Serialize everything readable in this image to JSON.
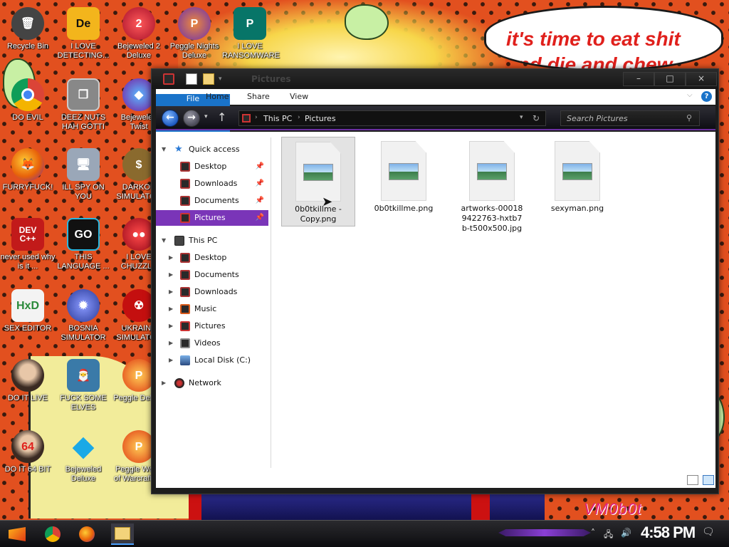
{
  "wallpaper": {
    "speech_bubble": "it's time to eat shit\nand die and chew",
    "signature": "VM0b0t"
  },
  "desktop_icons": [
    {
      "label": "Recycle Bin",
      "icon": "recycle-bin-icon",
      "color": "#444444"
    },
    {
      "label": "I LOVE DETECTING...",
      "icon": "detective-app-icon",
      "color": "#1a1a1a"
    },
    {
      "label": "Bejeweled 2 Deluxe",
      "icon": "bejeweled-2-icon",
      "color": "#d8182c"
    },
    {
      "label": "Peggle Nights Deluxe",
      "icon": "peggle-nights-icon",
      "color": "#6a2fb0"
    },
    {
      "label": "I LOVE RANSOMWARE",
      "icon": "publisher-icon",
      "color": "#077568"
    },
    {
      "label": "DO EVIL",
      "icon": "chrome-icon",
      "color": "#2d9e44"
    },
    {
      "label": "DEEZ NUTS HAH GOTTI",
      "icon": "copy-windows-icon",
      "color": "#777777"
    },
    {
      "label": "Bejeweled Twist",
      "icon": "bejeweled-twist-icon",
      "color": "#7a1a9e"
    },
    {
      "label": "FURRYFUCK!",
      "icon": "firefox-icon",
      "color": "#e8620a"
    },
    {
      "label": "ILL SPY ON YOU",
      "icon": "network-spy-icon",
      "color": "#9aa7b8"
    },
    {
      "label": "DARKOK SIMULATOR",
      "icon": "money-bag-icon",
      "color": "#8a6a2e"
    },
    {
      "label": "never used why is it ...",
      "icon": "devcpp-icon",
      "color": "#c21a1a"
    },
    {
      "label": "THIS LANGUAGE ...",
      "icon": "golang-icon",
      "color": "#1a1a1a"
    },
    {
      "label": "I LOVE CHUZZLE",
      "icon": "chuzzle-icon",
      "color": "#c2102a"
    },
    {
      "label": "SEX EDITOR",
      "icon": "hxd-editor-icon",
      "color": "#f3f3f3"
    },
    {
      "label": "BOSNIA SIMULATOR",
      "icon": "mine-icon",
      "color": "#4a5ab8"
    },
    {
      "label": "UKRAINE SIMULATOR",
      "icon": "radiation-icon",
      "color": "#c40f0f"
    },
    {
      "label": "DO IT LIVE",
      "icon": "portrait-icon",
      "color": "#6a4a3a"
    },
    {
      "label": "FUCK SOME ELVES",
      "icon": "santa-icon",
      "color": "#3a7aa8"
    },
    {
      "label": "Peggle Deluxe",
      "icon": "peggle-deluxe-icon",
      "color": "#e03a14"
    },
    {
      "label": "DO IT 64 BIT",
      "icon": "portrait-64-icon",
      "color": "#6a4a3a"
    },
    {
      "label": "Bejeweled Deluxe",
      "icon": "diamond-icon",
      "color": "#1aa9e6"
    },
    {
      "label": "Peggle World of Warcraft Ed",
      "icon": "peggle-wow-icon",
      "color": "#e03a14"
    }
  ],
  "window": {
    "title": "Pictures",
    "controls": {
      "minimize": "–",
      "maximize": "□",
      "close": "×"
    },
    "ribbon_tabs": [
      "File",
      "Home",
      "Share",
      "View"
    ],
    "address": {
      "segments": [
        "This PC",
        "Pictures"
      ]
    },
    "search_placeholder": "Search Pictures",
    "nav": {
      "quick_access": "Quick access",
      "quick_items": [
        "Desktop",
        "Downloads",
        "Documents",
        "Pictures"
      ],
      "this_pc": "This PC",
      "pc_items": [
        "Desktop",
        "Documents",
        "Downloads",
        "Music",
        "Pictures",
        "Videos",
        "Local Disk (C:)"
      ],
      "network": "Network"
    },
    "files": [
      {
        "name": "0b0tkillme - Copy.png",
        "selected": true
      },
      {
        "name": "0b0tkillme.png",
        "selected": false
      },
      {
        "name": "artworks-000189422763-hxtb7b-t500x500.jpg",
        "selected": false
      },
      {
        "name": "sexyman.png",
        "selected": false
      }
    ]
  },
  "taskbar": {
    "pinned": [
      "start-icon",
      "chrome-icon",
      "firefox-icon",
      "file-explorer-icon"
    ],
    "clock": "4:58 PM"
  }
}
